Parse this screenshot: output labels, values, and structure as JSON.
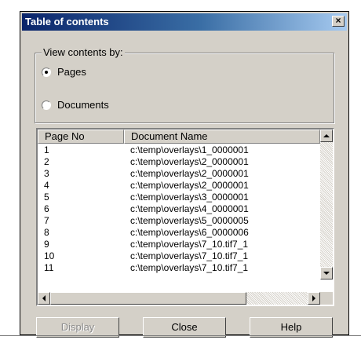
{
  "window": {
    "title": "Table of contents",
    "close_label": "×"
  },
  "group": {
    "label": "View contents by:",
    "options": [
      {
        "label": "Pages",
        "selected": true
      },
      {
        "label": "Documents",
        "selected": false
      }
    ]
  },
  "list": {
    "columns": [
      "Page No",
      "Document Name"
    ],
    "rows": [
      {
        "page": "1",
        "doc": "c:\\temp\\overlays\\1_0000001"
      },
      {
        "page": "2",
        "doc": "c:\\temp\\overlays\\2_0000001"
      },
      {
        "page": "3",
        "doc": "c:\\temp\\overlays\\2_0000001"
      },
      {
        "page": "4",
        "doc": "c:\\temp\\overlays\\2_0000001"
      },
      {
        "page": "5",
        "doc": "c:\\temp\\overlays\\3_0000001"
      },
      {
        "page": "6",
        "doc": "c:\\temp\\overlays\\4_0000001"
      },
      {
        "page": "7",
        "doc": "c:\\temp\\overlays\\5_0000005"
      },
      {
        "page": "8",
        "doc": "c:\\temp\\overlays\\6_0000006"
      },
      {
        "page": "9",
        "doc": "c:\\temp\\overlays\\7_10.tif7_1"
      },
      {
        "page": "10",
        "doc": "c:\\temp\\overlays\\7_10.tif7_1"
      },
      {
        "page": "11",
        "doc": "c:\\temp\\overlays\\7_10.tif7_1"
      }
    ]
  },
  "buttons": {
    "display": "Display",
    "close": "Close",
    "help": "Help"
  }
}
